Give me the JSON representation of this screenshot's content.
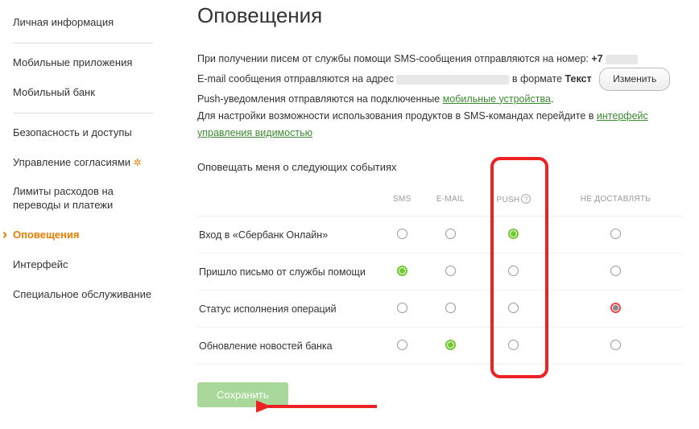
{
  "sidebar": {
    "items": [
      {
        "label": "Личная информация"
      },
      {
        "label": "Мобильные приложения"
      },
      {
        "label": "Мобильный банк"
      },
      {
        "label": "Безопасность и доступы"
      },
      {
        "label": "Управление согласиями",
        "marked": true
      },
      {
        "label": "Лимиты расходов на переводы и платежи"
      },
      {
        "label": "Оповещения",
        "active": true
      },
      {
        "label": "Интерфейс"
      },
      {
        "label": "Специальное обслуживание"
      }
    ]
  },
  "header": {
    "title": "Оповещения"
  },
  "info": {
    "line1_a": "При получении писем от службы помощи SMS-сообщения отправляются на номер: ",
    "line1_prefix": "+7",
    "line2_a": "E-mail сообщения отправляются на адрес ",
    "line2_b": " в формате ",
    "line2_format": "Текст",
    "change_btn": "Изменить",
    "line3_a": "Push-уведомления отправляются на подключенные ",
    "line3_link": "мобильные устройства",
    "line3_dot": ".",
    "line4_a": "Для настройки возможности использования продуктов в SMS-командах перейдите в ",
    "line4_link": "интерфейс управления видимостью"
  },
  "table": {
    "subtitle": "Оповещать меня о следующих событиях",
    "cols": [
      "SMS",
      "E-MAIL",
      "PUSH",
      "НЕ ДОСТАВЛЯТЬ"
    ],
    "help": "?",
    "rows": [
      {
        "label": "Вход в «Сбербанк Онлайн»",
        "sel": 2,
        "style": "green"
      },
      {
        "label": "Пришло письмо от службы помощи",
        "sel": 0,
        "style": "green"
      },
      {
        "label": "Статус исполнения операций",
        "sel": 3,
        "style": "red"
      },
      {
        "label": "Обновление новостей банка",
        "sel": 1,
        "style": "green"
      }
    ]
  },
  "actions": {
    "save": "Сохранить"
  }
}
